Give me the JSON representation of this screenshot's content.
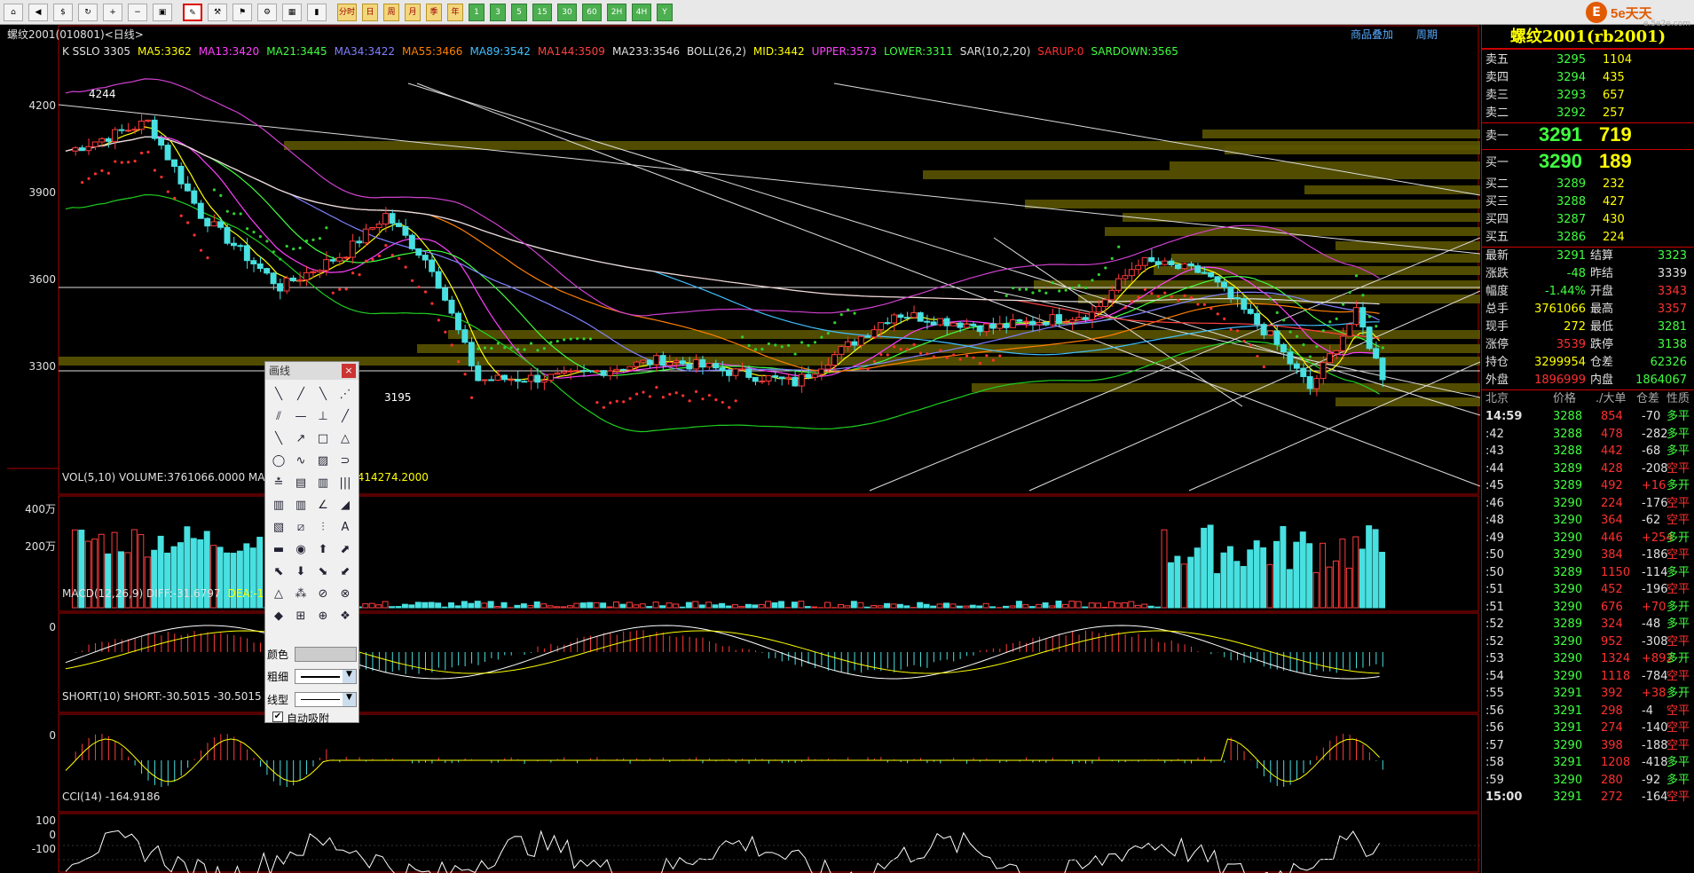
{
  "toolbar": {
    "items": [
      "home-icon",
      "back-icon",
      "quote-icon",
      "refresh-icon",
      "zoom-in-icon",
      "zoom-out-icon",
      "zoom-fit-icon",
      "draw-icon",
      "tools-icon",
      "indicator-icon",
      "settings-icon",
      "table-icon",
      "tick-icon",
      "分时",
      "日",
      "周",
      "月",
      "季",
      "年",
      "1",
      "3",
      "5",
      "15",
      "30",
      "60",
      "2H",
      "4H",
      "Y"
    ]
  },
  "logo": {
    "text": "5e天天",
    "sub": "e.5e2e.com"
  },
  "title": "螺纹2001(010801)<日线>",
  "topright": [
    "商品叠加",
    "周期"
  ],
  "main_legend": [
    {
      "t": "K  SSLO 3305",
      "c": "#e0e0e0"
    },
    {
      "t": "MA5:3362",
      "c": "#ffff00"
    },
    {
      "t": "MA13:3420",
      "c": "#ff40ff"
    },
    {
      "t": "MA21:3445",
      "c": "#40ff40"
    },
    {
      "t": "MA34:3422",
      "c": "#8080ff"
    },
    {
      "t": "MA55:3466",
      "c": "#ff8000"
    },
    {
      "t": "MA89:3542",
      "c": "#40c0ff"
    },
    {
      "t": "MA144:3509",
      "c": "#ff4040"
    },
    {
      "t": "MA233:3546",
      "c": "#e0e0e0"
    },
    {
      "t": "BOLL(26,2)",
      "c": "#e0e0e0"
    },
    {
      "t": "MID:3442",
      "c": "#ffff00"
    },
    {
      "t": "UPPER:3573",
      "c": "#ff40ff"
    },
    {
      "t": "LOWER:3311",
      "c": "#40ff40"
    },
    {
      "t": "SAR(10,2,20)",
      "c": "#e0e0e0"
    },
    {
      "t": "SARUP:0",
      "c": "#ff3030"
    },
    {
      "t": "SARDOWN:3565",
      "c": "#40ff40"
    }
  ],
  "y_main": [
    "4200",
    "3900",
    "3600",
    "3300"
  ],
  "price_marks": {
    "high": "4244",
    "low": "3195"
  },
  "vol_legend": [
    {
      "t": "VOL(5,10) VOLUME:3761066.0000 MAVOL1:",
      "c": "#e0e0e0"
    },
    {
      "t": "MAVOL2:3414274.2000",
      "c": "#ffff00"
    }
  ],
  "y_vol": [
    "400万",
    "200万"
  ],
  "macd_legend": [
    {
      "t": "MACD(12,26,9) DIFF:-31.6797",
      "c": "#e0e0e0"
    },
    {
      "t": "DEA:-16.5",
      "c": "#ffff00"
    }
  ],
  "y_macd": [
    "0"
  ],
  "short_legend": [
    {
      "t": "SHORT(10) SHORT:-30.5015 -30.5015 M",
      "c": "#e0e0e0"
    }
  ],
  "y_short": [
    "0"
  ],
  "cci_legend": [
    {
      "t": "CCI(14) -164.9186",
      "c": "#e0e0e0"
    }
  ],
  "y_cci": [
    "100",
    "0",
    "-100"
  ],
  "draw_panel": {
    "title": "画线",
    "close": "×",
    "color_label": "颜色",
    "width_label": "粗细",
    "style_label": "线型",
    "snap_label": "自动吸附"
  },
  "right": {
    "title": "螺纹2001(rb2001)",
    "asks": [
      {
        "l": "卖五",
        "p": "3295",
        "v": "1104"
      },
      {
        "l": "卖四",
        "p": "3294",
        "v": "435"
      },
      {
        "l": "卖三",
        "p": "3293",
        "v": "657"
      },
      {
        "l": "卖二",
        "p": "3292",
        "v": "257"
      }
    ],
    "ask1": {
      "l": "卖一",
      "p": "3291",
      "v": "719"
    },
    "bid1": {
      "l": "买一",
      "p": "3290",
      "v": "189"
    },
    "bids": [
      {
        "l": "买二",
        "p": "3289",
        "v": "232"
      },
      {
        "l": "买三",
        "p": "3288",
        "v": "427"
      },
      {
        "l": "买四",
        "p": "3287",
        "v": "430"
      },
      {
        "l": "买五",
        "p": "3286",
        "v": "224"
      }
    ],
    "stats": [
      {
        "l1": "最新",
        "v1": "3291",
        "c1": "#40ff40",
        "l2": "结算",
        "v2": "3323",
        "c2": "#40ff40"
      },
      {
        "l1": "涨跌",
        "v1": "-48",
        "c1": "#40ff40",
        "l2": "昨结",
        "v2": "3339",
        "c2": "#e0e0e0"
      },
      {
        "l1": "幅度",
        "v1": "-1.44%",
        "c1": "#40ff40",
        "l2": "开盘",
        "v2": "3343",
        "c2": "#ff3030"
      },
      {
        "l1": "总手",
        "v1": "3761066",
        "c1": "#ffff00",
        "l2": "最高",
        "v2": "3357",
        "c2": "#ff3030"
      },
      {
        "l1": "现手",
        "v1": "272",
        "c1": "#ffff00",
        "l2": "最低",
        "v2": "3281",
        "c2": "#40ff40"
      },
      {
        "l1": "涨停",
        "v1": "3539",
        "c1": "#ff3030",
        "l2": "跌停",
        "v2": "3138",
        "c2": "#40ff40"
      },
      {
        "l1": "持仓",
        "v1": "3299954",
        "c1": "#ffff00",
        "l2": "仓差",
        "v2": "62326",
        "c2": "#40ff40"
      },
      {
        "l1": "外盘",
        "v1": "1896999",
        "c1": "#ff3030",
        "l2": "内盘",
        "v2": "1864067",
        "c2": "#40ff40"
      }
    ],
    "tick_header": [
      "北京",
      "价格",
      "./大单",
      "仓差",
      "性质"
    ],
    "ticks": [
      {
        "t": "14:59",
        "p": "3288",
        "v": "854",
        "d": "-70",
        "n": "多平",
        "up": false
      },
      {
        "t": ":42",
        "p": "3288",
        "v": "478",
        "d": "-282",
        "n": "多平",
        "up": false
      },
      {
        "t": ":43",
        "p": "3288",
        "v": "442",
        "d": "-68",
        "n": "多平",
        "up": false
      },
      {
        "t": ":44",
        "p": "3289",
        "v": "428",
        "d": "-208",
        "n": "空平",
        "up": true
      },
      {
        "t": ":45",
        "p": "3289",
        "v": "492",
        "d": "+16",
        "n": "多开",
        "up": true
      },
      {
        "t": ":46",
        "p": "3290",
        "v": "224",
        "d": "-176",
        "n": "空平",
        "up": true
      },
      {
        "t": ":48",
        "p": "3290",
        "v": "364",
        "d": "-62",
        "n": "空平",
        "up": true
      },
      {
        "t": ":49",
        "p": "3290",
        "v": "446",
        "d": "+254",
        "n": "多开",
        "up": true
      },
      {
        "t": ":50",
        "p": "3290",
        "v": "384",
        "d": "-186",
        "n": "空平",
        "up": true
      },
      {
        "t": ":50",
        "p": "3289",
        "v": "1150",
        "d": "-114",
        "n": "多平",
        "up": false
      },
      {
        "t": ":51",
        "p": "3290",
        "v": "452",
        "d": "-196",
        "n": "空平",
        "up": true
      },
      {
        "t": ":51",
        "p": "3290",
        "v": "676",
        "d": "+70",
        "n": "多开",
        "up": true
      },
      {
        "t": ":52",
        "p": "3289",
        "v": "324",
        "d": "-48",
        "n": "多平",
        "up": false
      },
      {
        "t": ":52",
        "p": "3290",
        "v": "952",
        "d": "-308",
        "n": "空平",
        "up": true
      },
      {
        "t": ":53",
        "p": "3290",
        "v": "1324",
        "d": "+892",
        "n": "多开",
        "up": true
      },
      {
        "t": ":54",
        "p": "3290",
        "v": "1118",
        "d": "-784",
        "n": "空平",
        "up": true
      },
      {
        "t": ":55",
        "p": "3291",
        "v": "392",
        "d": "+38",
        "n": "多开",
        "up": true
      },
      {
        "t": ":56",
        "p": "3291",
        "v": "298",
        "d": "-4",
        "n": "空平",
        "up": true
      },
      {
        "t": ":56",
        "p": "3291",
        "v": "274",
        "d": "-140",
        "n": "空平",
        "up": true
      },
      {
        "t": ":57",
        "p": "3290",
        "v": "398",
        "d": "-188",
        "n": "空平",
        "up": true
      },
      {
        "t": ":58",
        "p": "3291",
        "v": "1208",
        "d": "-418",
        "n": "多平",
        "up": false
      },
      {
        "t": ":59",
        "p": "3290",
        "v": "280",
        "d": "-92",
        "n": "多平",
        "up": false
      },
      {
        "t": "15:00",
        "p": "3291",
        "v": "272",
        "d": "-164",
        "n": "空平",
        "up": true
      }
    ]
  }
}
